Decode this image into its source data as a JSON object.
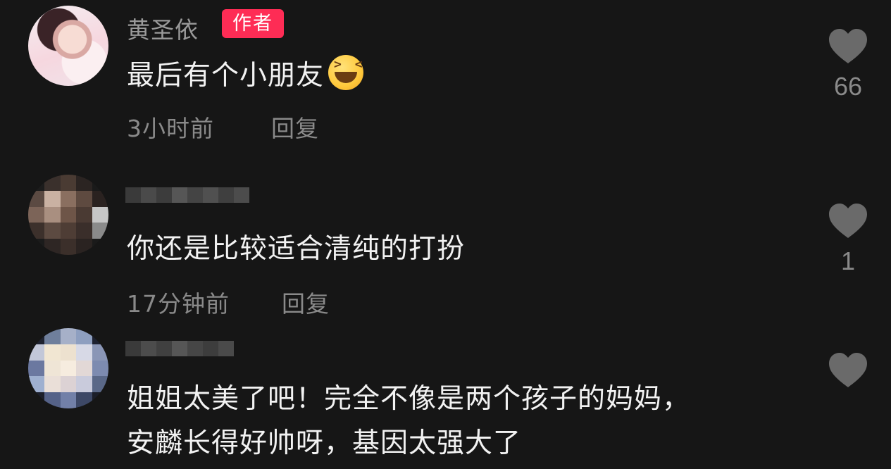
{
  "comments": [
    {
      "username": "黄圣依",
      "badge": "作者",
      "text": "最后有个小朋友",
      "emoji_icon": "laughing-squint-emoji-icon",
      "time": "3小时前",
      "reply_label": "回复",
      "likes": "66"
    },
    {
      "username_blurred": true,
      "text": "你还是比较适合清纯的打扮",
      "time": "17分钟前",
      "reply_label": "回复",
      "likes": "1"
    },
    {
      "username_blurred": true,
      "text_line1": "姐姐太美了吧！完全不像是两个孩子的妈妈，",
      "text_line2": "安麟长得好帅呀，基因太强大了"
    }
  ],
  "colors": {
    "background": "#161616",
    "author_badge": "#fe2c55",
    "muted_text": "#8a8a8a",
    "heart": "#6a6a6a"
  }
}
